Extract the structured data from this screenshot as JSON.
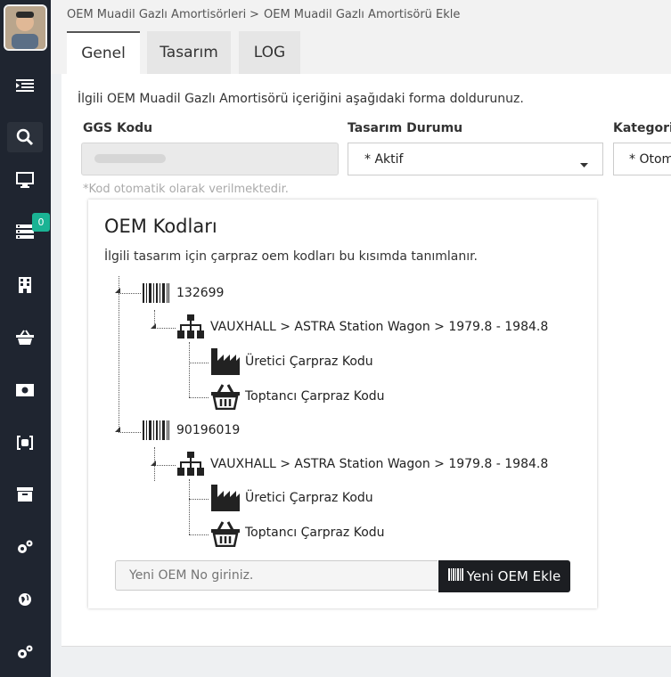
{
  "breadcrumb": {
    "item1": "OEM Muadil Gazlı Amortisörleri",
    "separator": ">",
    "item2": "OEM Muadil Gazlı Amortisörü Ekle"
  },
  "tabs": {
    "genel": "Genel",
    "tasarim": "Tasarım",
    "log": "LOG"
  },
  "form": {
    "intro": "İlgili OEM Muadil Gazlı Amortisörü içeriğini aşağıdaki forma doldurunuz.",
    "ggs_label": "GGS Kodu",
    "ggs_hint": "*Kod otomatik olarak verilmektedir.",
    "status_label": "Tasarım Durumu",
    "status_value": "* Aktif",
    "category_label": "Kategori",
    "category_value": "* Otom"
  },
  "sidebar": {
    "badge_count": "0"
  },
  "oem": {
    "title": "OEM Kodları",
    "description": "İlgili tasarım için çarpraz oem kodları bu kısımda tanımlanır.",
    "codes": [
      {
        "code": "132699",
        "vehicle": "VAUXHALL > ASTRA Station Wagon > 1979.8 - 1984.8",
        "producer": "Üretici Çarpraz Kodu",
        "wholesaler": "Toptancı Çarpraz Kodu"
      },
      {
        "code": "90196019",
        "vehicle": "VAUXHALL > ASTRA Station Wagon > 1979.8 - 1984.8",
        "producer": "Üretici Çarpraz Kodu",
        "wholesaler": "Toptancı Çarpraz Kodu"
      }
    ],
    "input_placeholder": "Yeni OEM No giriniz.",
    "add_button": "Yeni OEM Ekle"
  },
  "colors": {
    "sidebar_bg": "#1f2530",
    "badge": "#1ab394",
    "button_bg": "#1c1e22"
  }
}
